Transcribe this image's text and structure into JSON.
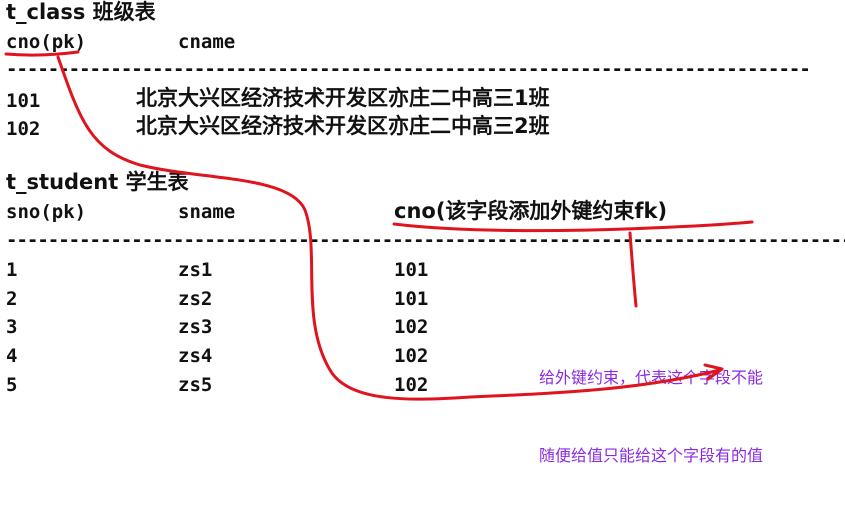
{
  "class_table": {
    "title": "t_class 班级表",
    "col1": "cno(pk)",
    "col2": "cname",
    "rows": [
      {
        "cno": "101",
        "cname": "北京大兴区经济技术开发区亦庄二中高三1班"
      },
      {
        "cno": "102",
        "cname": "北京大兴区经济技术开发区亦庄二中高三2班"
      }
    ]
  },
  "student_table": {
    "title": "t_student 学生表",
    "col1": "sno(pk)",
    "col2": "sname",
    "col3": "cno(该字段添加外键约束fk)",
    "rows": [
      {
        "sno": "1",
        "sname": "zs1",
        "cno": "101"
      },
      {
        "sno": "2",
        "sname": "zs2",
        "cno": "101"
      },
      {
        "sno": "3",
        "sname": "zs3",
        "cno": "102"
      },
      {
        "sno": "4",
        "sname": "zs4",
        "cno": "102"
      },
      {
        "sno": "5",
        "sname": "zs5",
        "cno": "102"
      }
    ]
  },
  "separator": "--------------------------------------------------------------------------------------------------------",
  "annotation": {
    "line1": "给外键约束，代表这个字段不能",
    "line2": "随便给值只能给这个字段有的值"
  },
  "colors": {
    "text": "#111111",
    "annotation": "#8a2be2",
    "pen": "#e0141e"
  }
}
